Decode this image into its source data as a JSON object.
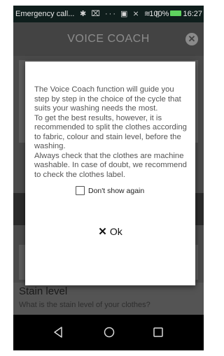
{
  "status_bar": {
    "left_text": "Emergency call...",
    "icons": "✱ ⌧ ··· ▣ ⨯ ≋ ▯",
    "battery": "100%",
    "time": "16:27"
  },
  "header": {
    "title": "VOICE COACH"
  },
  "background": {
    "stain_title": "Stain level",
    "stain_subtitle": "What is the stain level of your clothes?"
  },
  "dialog": {
    "message": "The Voice Coach function will guide you step by step in the choice of the cycle that suits your washing needs the most.\nTo get the best results, however, it is recommended to split the clothes according to fabric, colour and stain level, before the washing.\nAlways check that the clothes are machine washable. In case of doubt, we recommend to check the clothes label.",
    "checkbox_label": "Don't show again",
    "checkbox_checked": false,
    "ok_label": "Ok"
  },
  "colors": {
    "status_bar": "#0f1e1c",
    "header": "#434343",
    "overlay": "#4a4a4a",
    "battery": "#5fd35f"
  }
}
